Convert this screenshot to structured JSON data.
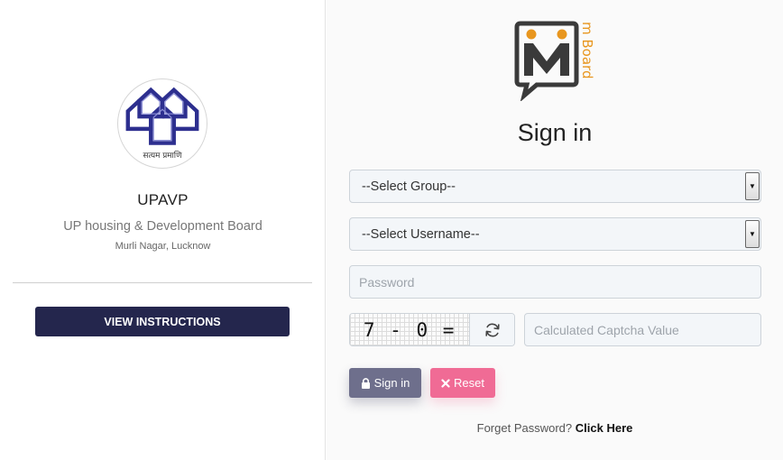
{
  "organization": {
    "logo_caption": "सत्यम प्रमाणि",
    "name": "UPAVP",
    "subtitle": "UP housing & Development Board",
    "location": "Murli Nagar, Lucknow",
    "instructions_button": "VIEW INSTRUCTIONS"
  },
  "brand": {
    "logo_letter": "M",
    "logo_side_text": "m Board",
    "colors": {
      "primary": "#3a3a3a",
      "accent": "#e8961e"
    }
  },
  "signin": {
    "heading": "Sign in",
    "group_select": {
      "selected": "--Select Group--"
    },
    "username_select": {
      "selected": "--Select Username--"
    },
    "password": {
      "placeholder": "Password",
      "value": ""
    },
    "captcha": {
      "image_text": "7 - 0 =",
      "refresh_icon": "refresh-icon",
      "input": {
        "placeholder": "Calculated Captcha Value",
        "value": ""
      }
    },
    "buttons": {
      "signin_label": "Sign in",
      "signin_icon": "lock-icon",
      "reset_label": "Reset",
      "reset_icon": "close-icon"
    },
    "forgot": {
      "text": "Forget Password?",
      "link": "Click Here"
    }
  },
  "colors": {
    "instructions_button": "#24264d",
    "signin_button": "#6e6f8c",
    "reset_button": "#f06b95"
  }
}
